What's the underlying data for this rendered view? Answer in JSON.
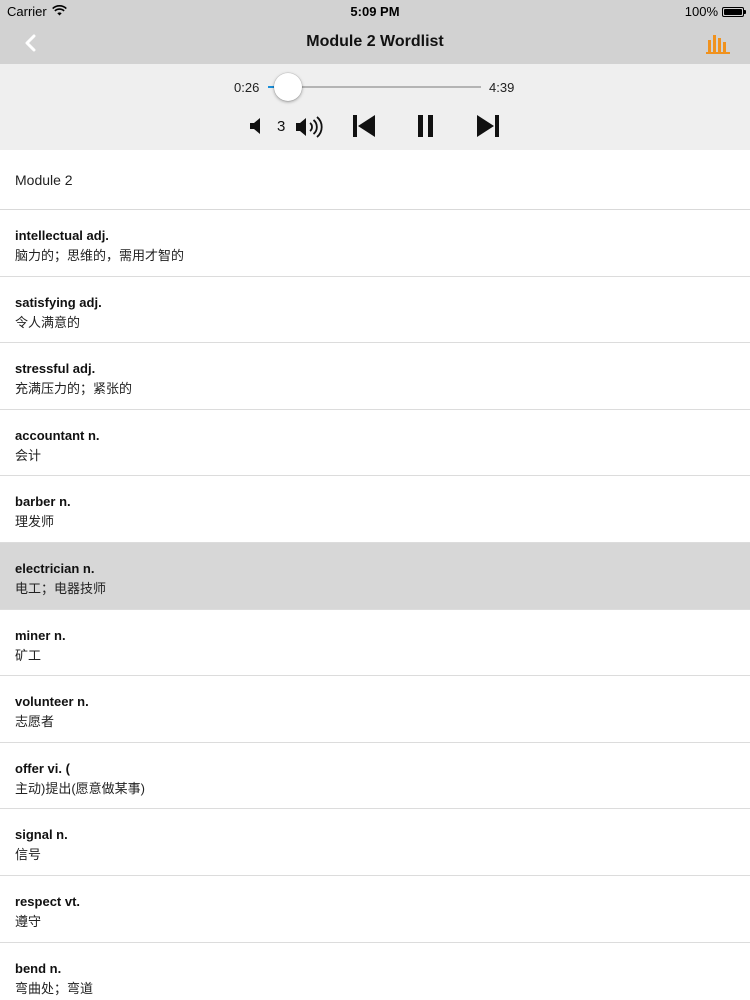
{
  "status_bar": {
    "carrier": "Carrier",
    "time": "5:09 PM",
    "battery": "100%",
    "battery_level": 1.0
  },
  "nav": {
    "title": "Module 2 Wordlist",
    "back_icon": "chevron-left-icon",
    "chart_icon": "bar-chart-icon",
    "accent_color": "#f0921e"
  },
  "player": {
    "elapsed": "0:26",
    "duration": "4:39",
    "progress": 0.093,
    "volume": "3",
    "progress_color": "#1b8fd9"
  },
  "list": {
    "header": "Module 2",
    "items": [
      {
        "term": "intellectual adj.",
        "meaning": "脑力的；思维的，需用才智的",
        "selected": false
      },
      {
        "term": "satisfying adj.",
        "meaning": "令人满意的",
        "selected": false
      },
      {
        "term": "stressful adj.",
        "meaning": "充满压力的；紧张的",
        "selected": false
      },
      {
        "term": "accountant n.",
        "meaning": "会计",
        "selected": false
      },
      {
        "term": "barber n.",
        "meaning": "理发师",
        "selected": false
      },
      {
        "term": "electrician n.",
        "meaning": "电工；电器技师",
        "selected": true
      },
      {
        "term": "miner n.",
        "meaning": "矿工",
        "selected": false
      },
      {
        "term": "volunteer n.",
        "meaning": "志愿者",
        "selected": false
      },
      {
        "term": "offer vi. (",
        "meaning": "主动)提出(愿意做某事)",
        "selected": false
      },
      {
        "term": "signal n.",
        "meaning": "信号",
        "selected": false
      },
      {
        "term": "respect vt.",
        "meaning": "遵守",
        "selected": false
      },
      {
        "term": "bend n.",
        "meaning": "弯曲处；弯道",
        "selected": false
      }
    ]
  }
}
